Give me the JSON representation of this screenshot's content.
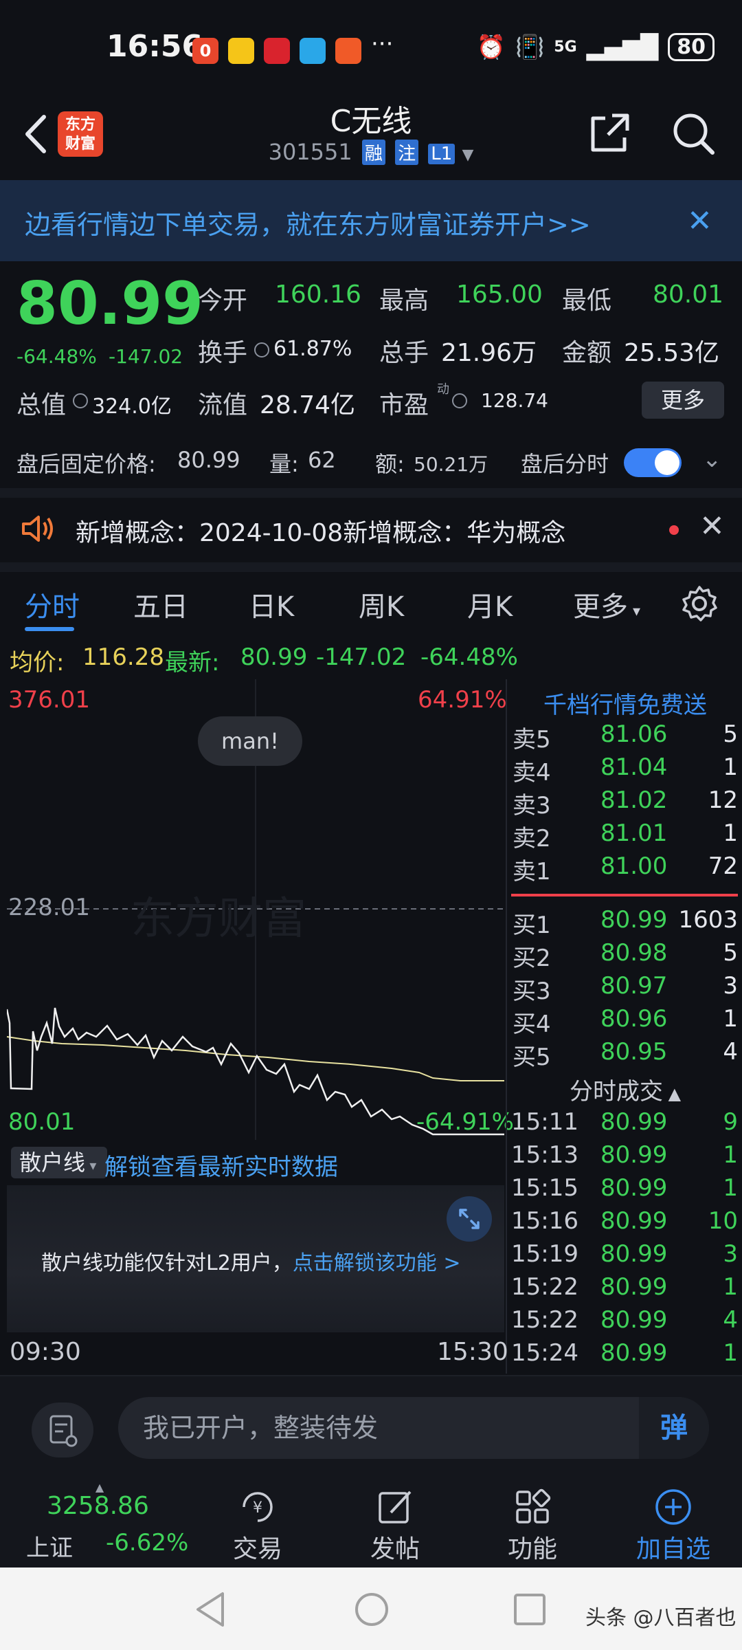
{
  "status": {
    "time": "16:56",
    "network": "5G",
    "battery": "80",
    "app_badge": "0"
  },
  "header": {
    "stock_name": "C无线",
    "stock_code": "301551",
    "tags": [
      "融",
      "注",
      "L1"
    ],
    "logo_text": "东方财富"
  },
  "banner": {
    "text": "边看行情边下单交易，就在东方财富证券开户>>"
  },
  "quote": {
    "price": "80.99",
    "pct": "-64.48%",
    "chg": "-147.02",
    "open_label": "今开",
    "open": "160.16",
    "high_label": "最高",
    "high": "165.00",
    "low_label": "最低",
    "low": "80.01",
    "turnover_label": "换手",
    "turnover": "61.87%",
    "volume_label": "总手",
    "volume": "21.96万",
    "amount_label": "金额",
    "amount": "25.53亿",
    "mktcap_label": "总值",
    "mktcap": "324.0亿",
    "float_label": "流值",
    "float": "28.74亿",
    "pe_label": "市盈",
    "pe_sup": "动",
    "pe": "128.74",
    "more": "更多"
  },
  "after_hours": {
    "price_label": "盘后固定价格:",
    "price": "80.99",
    "qty_label": "量:",
    "qty": "62",
    "amt_label": "额:",
    "amt": "50.21万",
    "toggle_label": "盘后分时"
  },
  "concept": {
    "text": "新增概念：2024-10-08新增概念：华为概念"
  },
  "tabs": [
    "分时",
    "五日",
    "日K",
    "周K",
    "月K",
    "更多"
  ],
  "avg_row": {
    "avg_label": "均价:",
    "avg": "116.28",
    "latest_label": "最新:",
    "latest": "80.99",
    "chg": "-147.02",
    "pct": "-64.48%"
  },
  "chart": {
    "y_top": "376.01",
    "y_mid": "228.01",
    "y_bot": "80.01",
    "pct_top": "64.91%",
    "pct_bot": "-64.91%",
    "bubble": "man!",
    "watermark": "东方财富",
    "time_start": "09:30",
    "time_end": "15:30"
  },
  "book": {
    "title": "千档行情免费送",
    "asks": [
      {
        "label": "卖5",
        "price": "81.06",
        "vol": "5"
      },
      {
        "label": "卖4",
        "price": "81.04",
        "vol": "1"
      },
      {
        "label": "卖3",
        "price": "81.02",
        "vol": "12"
      },
      {
        "label": "卖2",
        "price": "81.01",
        "vol": "1"
      },
      {
        "label": "卖1",
        "price": "81.00",
        "vol": "72"
      }
    ],
    "bids": [
      {
        "label": "买1",
        "price": "80.99",
        "vol": "1603"
      },
      {
        "label": "买2",
        "price": "80.98",
        "vol": "5"
      },
      {
        "label": "买3",
        "price": "80.97",
        "vol": "3"
      },
      {
        "label": "买4",
        "price": "80.96",
        "vol": "1"
      },
      {
        "label": "买5",
        "price": "80.95",
        "vol": "4"
      }
    ],
    "trades_title": "分时成交",
    "trades": [
      {
        "time": "15:11",
        "price": "80.99",
        "vol": "9"
      },
      {
        "time": "15:13",
        "price": "80.99",
        "vol": "1"
      },
      {
        "time": "15:15",
        "price": "80.99",
        "vol": "1"
      },
      {
        "time": "15:16",
        "price": "80.99",
        "vol": "10"
      },
      {
        "time": "15:19",
        "price": "80.99",
        "vol": "3"
      },
      {
        "time": "15:22",
        "price": "80.99",
        "vol": "1"
      },
      {
        "time": "15:22",
        "price": "80.99",
        "vol": "4"
      },
      {
        "time": "15:24",
        "price": "80.99",
        "vol": "1"
      }
    ]
  },
  "retail": {
    "button": "散户线",
    "link": "解锁查看最新实时数据",
    "msg": "散户线功能仅针对L2用户，",
    "msg_link": "点击解锁该功能 >"
  },
  "input": {
    "placeholder": "我已开户，整装待发",
    "danmu": "弹"
  },
  "nav": {
    "index_value": "3258.86",
    "index_name": "上证",
    "index_pct": "-6.62%",
    "trade": "交易",
    "post": "发帖",
    "features": "功能",
    "add": "加自选"
  },
  "footer": {
    "watermark": "头条 @八百者也"
  }
}
